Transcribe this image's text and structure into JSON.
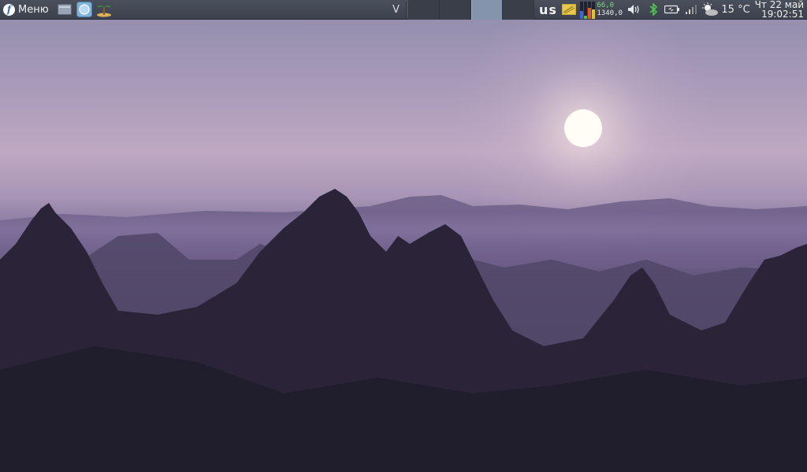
{
  "panel": {
    "menu_label": "Меню",
    "tasklist_handle": "V",
    "workspaces": [
      {
        "active": false
      },
      {
        "active": false
      },
      {
        "active": true
      },
      {
        "active": false
      }
    ],
    "keyboard_layout": "us",
    "netspeed": {
      "download": "66,0",
      "upload": "1340,0"
    },
    "weather_temp": "15 °C",
    "clock": {
      "date": "Чт 22 май",
      "time": "19:02:51"
    }
  },
  "icons": {
    "menu": "fedora-logo-icon",
    "launchers": [
      "file-manager-icon",
      "browser-icon",
      "island-icon"
    ],
    "tray": [
      "sticky-note-icon",
      "system-monitor-icon",
      "volume-icon",
      "bluetooth-icon",
      "battery-icon",
      "signal-icon",
      "weather-icon"
    ]
  },
  "colors": {
    "panel": "#40454f",
    "active_workspace": "#8494aa",
    "bluetooth": "#4fc24f",
    "netspeed_down": "#7dd87d"
  }
}
